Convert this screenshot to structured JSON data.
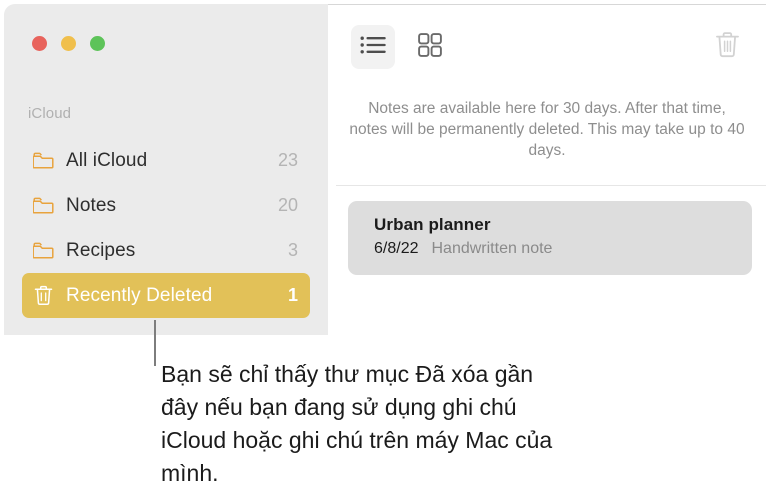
{
  "window": {
    "traffic_lights": [
      {
        "name": "close",
        "color": "#e8635c"
      },
      {
        "name": "minimize",
        "color": "#f0bf4c"
      },
      {
        "name": "maximize",
        "color": "#5dc359"
      }
    ]
  },
  "sidebar": {
    "section_header": "iCloud",
    "selected_accent": "#e2c158",
    "folder_icon_color": "#e8a33d",
    "items": [
      {
        "label": "All iCloud",
        "count": "23",
        "icon": "folder-icon",
        "selected": false
      },
      {
        "label": "Notes",
        "count": "20",
        "icon": "folder-icon",
        "selected": false
      },
      {
        "label": "Recipes",
        "count": "3",
        "icon": "folder-icon",
        "selected": false
      },
      {
        "label": "Recently Deleted",
        "count": "1",
        "icon": "trash-icon",
        "selected": true
      }
    ]
  },
  "toolbar": {
    "view_list_label": "list-view-icon",
    "view_grid_label": "gallery-view-icon",
    "delete_label": "trash-icon"
  },
  "main": {
    "retention_message": "Notes are available here for 30 days. After that time, notes will be permanently deleted. This may take up to 40 days.",
    "notes": [
      {
        "title": "Urban planner",
        "date": "6/8/22",
        "subtitle": "Handwritten note"
      }
    ]
  },
  "callout": {
    "text": "Bạn sẽ chỉ thấy thư mục Đã xóa gần đây nếu bạn đang sử dụng ghi chú iCloud hoặc ghi chú trên máy Mac của mình."
  }
}
